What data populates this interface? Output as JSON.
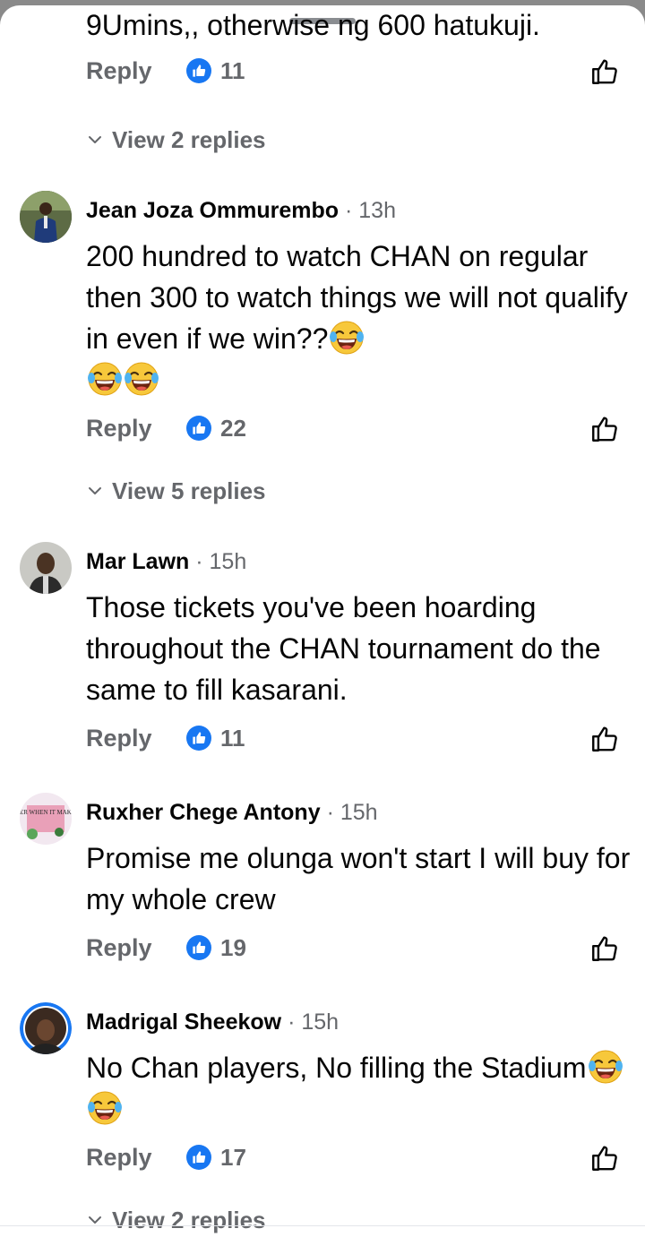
{
  "top_partial": {
    "text": "9Umins,, otherwise ng 600 hatukuji.",
    "reply_label": "Reply",
    "like_count": "11",
    "view_replies": "View 2 replies"
  },
  "comments": [
    {
      "author": "Jean Joza Ommurembo",
      "separator": "·",
      "time": "13h",
      "text": "200 hundred to watch CHAN on regular then 300 to watch things we will not qualify in even if we win??",
      "emoji_count": 3,
      "reply_label": "Reply",
      "like_count": "22",
      "view_replies": "View 5 replies"
    },
    {
      "author": "Mar Lawn",
      "separator": "·",
      "time": "15h",
      "text": "Those tickets you've been hoarding throughout the CHAN tournament do the same to fill kasarani.",
      "reply_label": "Reply",
      "like_count": "11"
    },
    {
      "author": "Ruxher Chege Antony",
      "separator": "·",
      "time": "15h",
      "text": "Promise me olunga won't start I will buy for my whole crew",
      "avatar_caption": "IT MATTER WHEN IT MAKE SENSE",
      "reply_label": "Reply",
      "like_count": "19"
    },
    {
      "author": "Madrigal Sheekow",
      "separator": "·",
      "time": "15h",
      "text": "No Chan players, No filling the Stadium",
      "emoji_count": 2,
      "reply_label": "Reply",
      "like_count": "17",
      "view_replies": "View 2 replies"
    }
  ],
  "icons": {
    "reaction": "like-reaction-icon",
    "like_button": "thumbs-up-outline-icon",
    "chevron": "chevron-down-icon",
    "emoji": "face-with-tears-of-joy-icon"
  },
  "colors": {
    "accent": "#1877f2",
    "secondary_text": "#65676b",
    "primary_text": "#050505",
    "background": "#ffffff",
    "backdrop": "#8a8a8a"
  }
}
